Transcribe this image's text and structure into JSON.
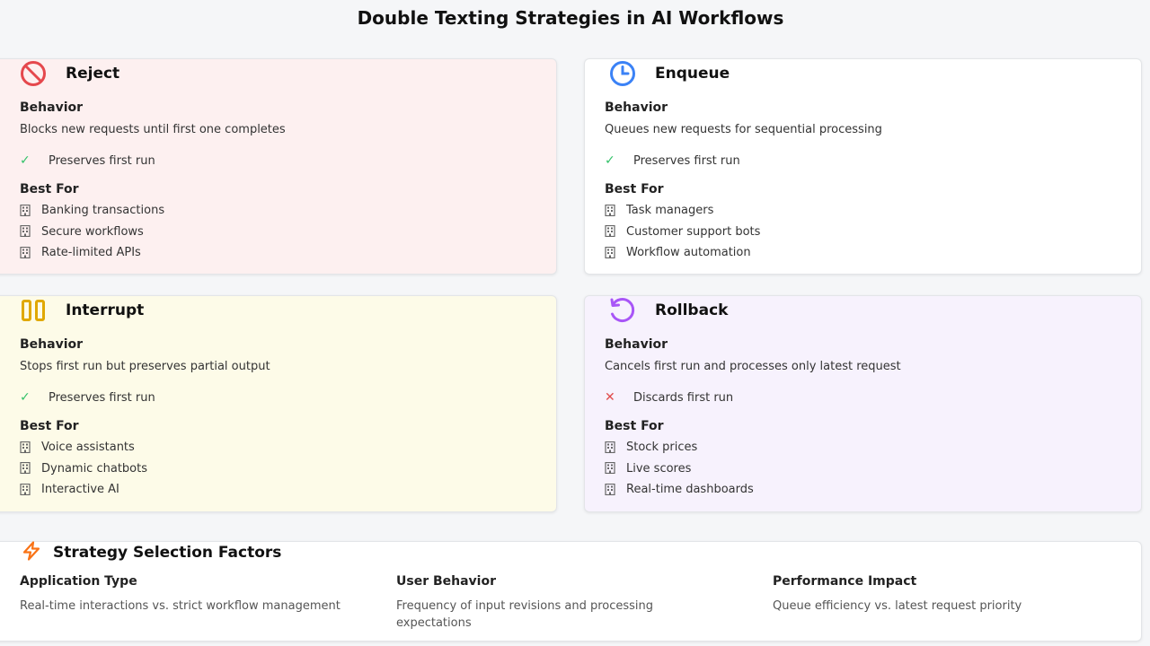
{
  "title": "Double Texting Strategies in AI Workflows",
  "colors": {
    "reject_accent": "#e5484d",
    "enqueue_accent": "#3b82f6",
    "interrupt_accent": "#e0a800",
    "rollback_accent": "#a855f7",
    "factors_accent": "#f97316",
    "check": "#34c26a",
    "cross": "#e04b4b"
  },
  "strategies": [
    {
      "name": "Reject",
      "icon": "prohibited-icon",
      "behavior_label": "Behavior",
      "behavior": "Blocks new requests until first one completes",
      "status": "Preserves first run",
      "status_type": "check",
      "best_for_label": "Best For",
      "best_for": [
        "Banking transactions",
        "Secure workflows",
        "Rate-limited APIs"
      ]
    },
    {
      "name": "Enqueue",
      "icon": "clock-icon",
      "behavior_label": "Behavior",
      "behavior": "Queues new requests for sequential processing",
      "status": "Preserves first run",
      "status_type": "check",
      "best_for_label": "Best For",
      "best_for": [
        "Task managers",
        "Customer support bots",
        "Workflow automation"
      ]
    },
    {
      "name": "Interrupt",
      "icon": "pause-icon",
      "behavior_label": "Behavior",
      "behavior": "Stops first run but preserves partial output",
      "status": "Preserves first run",
      "status_type": "check",
      "best_for_label": "Best For",
      "best_for": [
        "Voice assistants",
        "Dynamic chatbots",
        "Interactive AI"
      ]
    },
    {
      "name": "Rollback",
      "icon": "rotate-ccw-icon",
      "behavior_label": "Behavior",
      "behavior": "Cancels first run and processes only latest request",
      "status": "Discards first run",
      "status_type": "cross",
      "best_for_label": "Best For",
      "best_for": [
        "Stock prices",
        "Live scores",
        "Real-time dashboards"
      ]
    }
  ],
  "factors": {
    "title": "Strategy Selection Factors",
    "icon": "lightning-icon",
    "items": [
      {
        "label": "Application Type",
        "desc": "Real-time interactions vs. strict workflow management"
      },
      {
        "label": "User Behavior",
        "desc": "Frequency of input revisions and processing expectations"
      },
      {
        "label": "Performance Impact",
        "desc": "Queue efficiency vs. latest request priority"
      }
    ]
  }
}
